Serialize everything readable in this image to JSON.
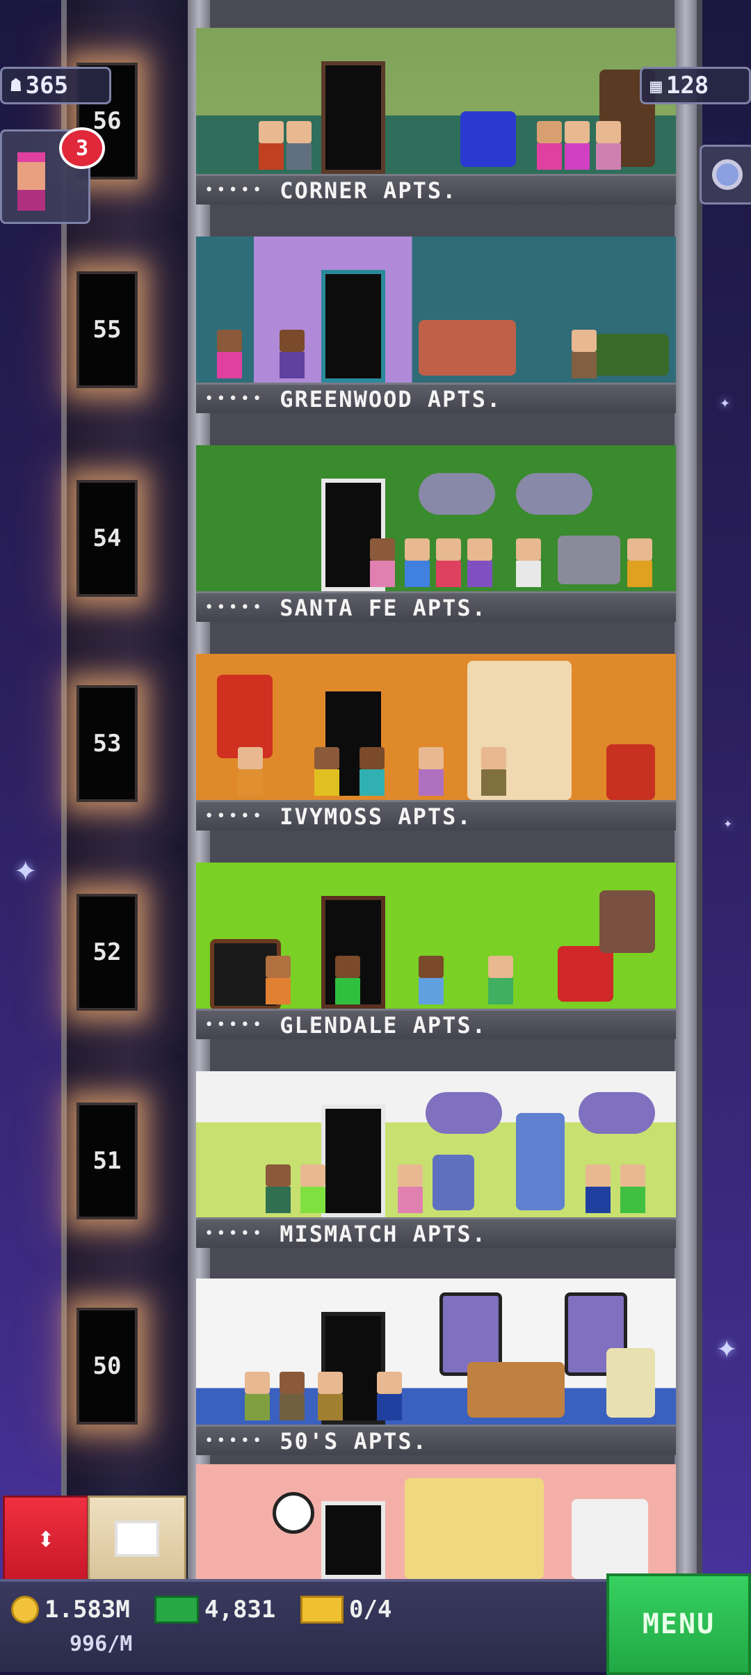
{
  "stats": {
    "population": "365",
    "floors": "128",
    "notifications": "3"
  },
  "floors": [
    {
      "number": "56",
      "name": "CORNER APTS."
    },
    {
      "number": "55",
      "name": "GREENWOOD APTS."
    },
    {
      "number": "54",
      "name": "SANTA FE APTS."
    },
    {
      "number": "53",
      "name": "IVYMOSS APTS."
    },
    {
      "number": "52",
      "name": "GLENDALE APTS."
    },
    {
      "number": "51",
      "name": "MISMATCH APTS."
    },
    {
      "number": "50",
      "name": "50'S APTS."
    }
  ],
  "nameplate_dots": "•••••",
  "bottom": {
    "coins": "1.583M",
    "coin_rate": "996/M",
    "bux": "4,831",
    "tickets": "0/4",
    "menu_label": "MENU"
  },
  "colors": {
    "accent_green": "#2cc250",
    "accent_red": "#e0283a",
    "sky": "#2a1f5c"
  }
}
